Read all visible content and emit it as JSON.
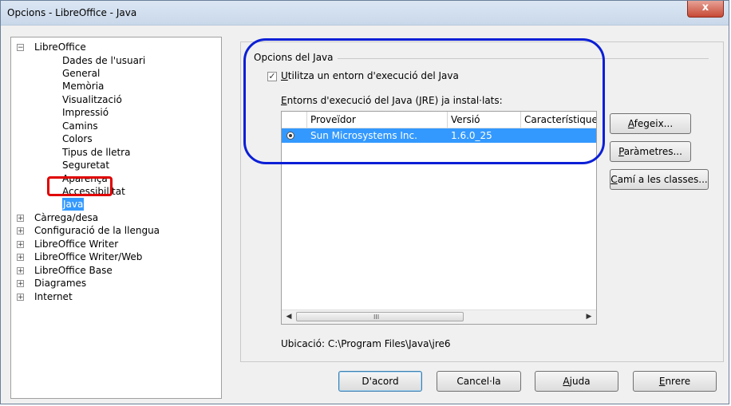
{
  "window": {
    "title": "Opcions - LibreOffice - Java",
    "close_label": "x"
  },
  "tree": {
    "root": {
      "label": "LibreOffice",
      "expander": "−"
    },
    "children": [
      "Dades de l'usuari",
      "General",
      "Memòria",
      "Visualització",
      "Impressió",
      "Camins",
      "Colors",
      "Tipus de lletra",
      "Seguretat",
      "Aparença",
      "Accessibilitat",
      "Java"
    ],
    "selected": "Java",
    "other_roots": [
      {
        "label": "Càrrega/desa",
        "expander": "+"
      },
      {
        "label": "Configuració de la llengua",
        "expander": "+"
      },
      {
        "label": "LibreOffice Writer",
        "expander": "+"
      },
      {
        "label": "LibreOffice Writer/Web",
        "expander": "+"
      },
      {
        "label": "LibreOffice Base",
        "expander": "+"
      },
      {
        "label": "Diagrames",
        "expander": "+"
      },
      {
        "label": "Internet",
        "expander": "+"
      }
    ]
  },
  "java": {
    "group_title": "Opcions del Java",
    "use_jre_label": "Utilitza un entorn d'execució del Java",
    "use_jre_checked": true,
    "installed_label": "Entorns d'execució del Java (JRE) ja instal·lats:",
    "columns": [
      "Proveïdor",
      "Versió",
      "Característiques"
    ],
    "rows": [
      {
        "vendor": "Sun Microsystems Inc.",
        "version": "1.6.0_25",
        "features": ""
      }
    ],
    "scroll_grip": "III",
    "location": "Ubicació: C:\\Program Files\\Java\\jre6",
    "buttons": {
      "add": "Afegeix...",
      "parameters": "Paràmetres...",
      "classpath": "Camí a les classes..."
    }
  },
  "footer": {
    "ok": "D'acord",
    "cancel": "Cancel·la",
    "help": "Ajuda",
    "back": "Enrere"
  },
  "colors": {
    "selection": "#3399ff",
    "annotation_red": "#e00000",
    "annotation_blue": "#0b1fd6"
  }
}
